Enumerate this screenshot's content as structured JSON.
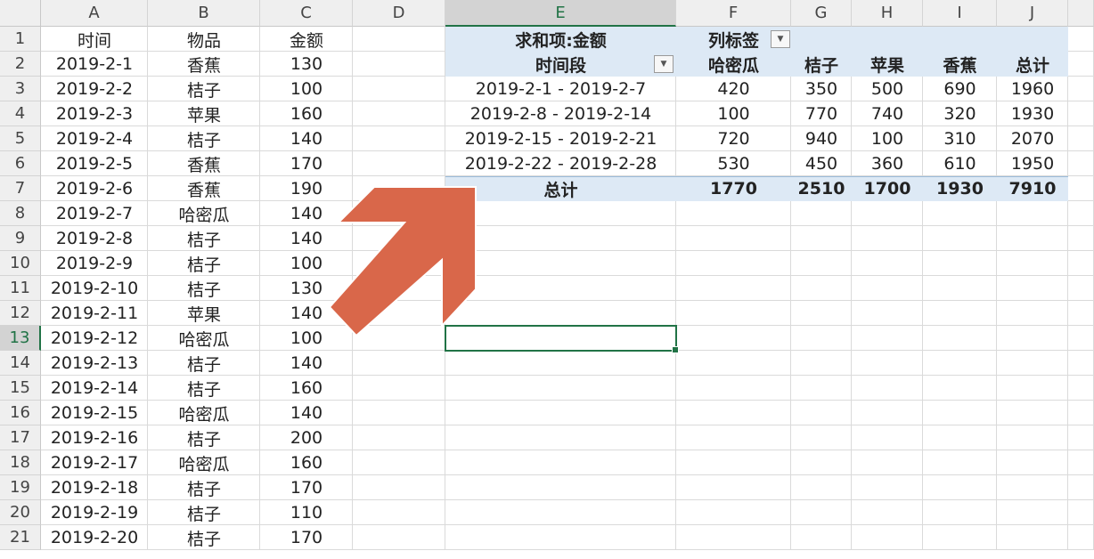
{
  "columns": [
    "A",
    "B",
    "C",
    "D",
    "E",
    "F",
    "G",
    "H",
    "I",
    "J"
  ],
  "selected_column": "E",
  "selected_row": 13,
  "source_headers": [
    "时间",
    "物品",
    "金额"
  ],
  "source_rows": [
    [
      "2019-2-1",
      "香蕉",
      "130"
    ],
    [
      "2019-2-2",
      "桔子",
      "100"
    ],
    [
      "2019-2-3",
      "苹果",
      "160"
    ],
    [
      "2019-2-4",
      "桔子",
      "140"
    ],
    [
      "2019-2-5",
      "香蕉",
      "170"
    ],
    [
      "2019-2-6",
      "香蕉",
      "190"
    ],
    [
      "2019-2-7",
      "哈密瓜",
      "140"
    ],
    [
      "2019-2-8",
      "桔子",
      "140"
    ],
    [
      "2019-2-9",
      "桔子",
      "100"
    ],
    [
      "2019-2-10",
      "桔子",
      "130"
    ],
    [
      "2019-2-11",
      "苹果",
      "140"
    ],
    [
      "2019-2-12",
      "哈密瓜",
      "100"
    ],
    [
      "2019-2-13",
      "桔子",
      "140"
    ],
    [
      "2019-2-14",
      "桔子",
      "160"
    ],
    [
      "2019-2-15",
      "哈密瓜",
      "140"
    ],
    [
      "2019-2-16",
      "桔子",
      "200"
    ],
    [
      "2019-2-17",
      "哈密瓜",
      "160"
    ],
    [
      "2019-2-18",
      "桔子",
      "170"
    ],
    [
      "2019-2-19",
      "桔子",
      "110"
    ],
    [
      "2019-2-20",
      "桔子",
      "170"
    ]
  ],
  "pivot": {
    "values_label": "求和项:金额",
    "column_labels": "列标签",
    "row_field": "时间段",
    "column_items": [
      "哈密瓜",
      "桔子",
      "苹果",
      "香蕉",
      "总计"
    ],
    "rows": [
      {
        "label": "2019-2-1 - 2019-2-7",
        "values": [
          "420",
          "350",
          "500",
          "690",
          "1960"
        ]
      },
      {
        "label": "2019-2-8 - 2019-2-14",
        "values": [
          "100",
          "770",
          "740",
          "320",
          "1930"
        ]
      },
      {
        "label": "2019-2-15 - 2019-2-21",
        "values": [
          "720",
          "940",
          "100",
          "310",
          "2070"
        ]
      },
      {
        "label": "2019-2-22 - 2019-2-28",
        "values": [
          "530",
          "450",
          "360",
          "610",
          "1950"
        ]
      }
    ],
    "grand_total": {
      "label": "总计",
      "values": [
        "1770",
        "2510",
        "1700",
        "1930",
        "7910"
      ]
    },
    "header_fill_color": "#dde9f5"
  },
  "annotation": {
    "arrow_color": "#d9674a",
    "arrow_icon": "arrow-up-right-icon"
  }
}
